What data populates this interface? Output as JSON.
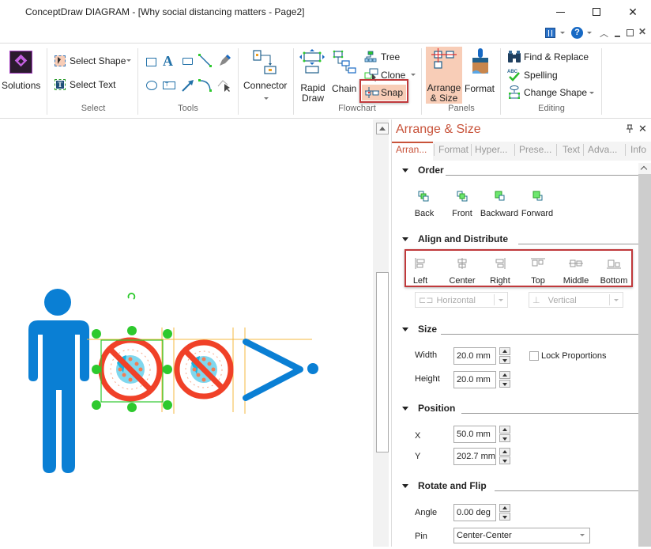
{
  "window": {
    "title": "ConceptDraw DIAGRAM - [Why social distancing matters - Page2]",
    "controls": {
      "minimize": "—",
      "maximize": "☐",
      "close": "✕"
    }
  },
  "quick_bar": {
    "icons": [
      "panel-layout-icon",
      "help-icon",
      "collapse-ribbon-icon",
      "mdi-minimize-icon",
      "mdi-restore-icon",
      "mdi-close-icon"
    ],
    "help_glyph": "?",
    "collapse_glyph": "︿",
    "min_glyph": "_",
    "restore_glyph": "🗗",
    "close_glyph": "✕"
  },
  "ribbon": {
    "solutions": {
      "label": "Solutions"
    },
    "select_group": {
      "label": "Select",
      "select_shape": "Select Shape",
      "select_text": "Select Text"
    },
    "tools_group": {
      "label": "Tools"
    },
    "connector": {
      "label": "Connector"
    },
    "flowchart_group": {
      "label": "Flowchart",
      "rapid_draw_1": "Rapid",
      "rapid_draw_2": "Draw",
      "chain": "Chain",
      "tree": "Tree",
      "clone": "Clone",
      "snap": "Snap"
    },
    "panels_group": {
      "label": "Panels",
      "arrange_1": "Arrange",
      "arrange_2": "& Size",
      "format": "Format"
    },
    "editing_group": {
      "label": "Editing",
      "find_replace": "Find & Replace",
      "spelling": "Spelling",
      "change_shape": "Change Shape"
    }
  },
  "panel": {
    "title": "Arrange & Size",
    "pin_glyph": "📌",
    "close_glyph": "✕",
    "tabs": [
      {
        "label": "Arran...",
        "active": true
      },
      {
        "label": "Format",
        "active": false
      },
      {
        "label": "Hyper...",
        "active": false
      },
      {
        "label": "Prese...",
        "active": false
      },
      {
        "label": "Text",
        "active": false
      },
      {
        "label": "Adva...",
        "active": false
      },
      {
        "label": "Info",
        "active": false
      }
    ],
    "order": {
      "heading": "Order",
      "buttons": [
        "Back",
        "Front",
        "Backward",
        "Forward"
      ]
    },
    "align": {
      "heading": "Align and Distribute",
      "buttons": [
        "Left",
        "Center",
        "Right",
        "Top",
        "Middle",
        "Bottom"
      ],
      "horizontal": "Horizontal",
      "vertical": "Vertical"
    },
    "size": {
      "heading": "Size",
      "width_label": "Width",
      "width_value": "20.0 mm",
      "height_label": "Height",
      "height_value": "20.0 mm",
      "lock_label": "Lock Proportions",
      "lock_checked": false
    },
    "position": {
      "heading": "Position",
      "x_label": "X",
      "x_value": "50.0 mm",
      "y_label": "Y",
      "y_value": "202.7 mm"
    },
    "rotate": {
      "heading": "Rotate and Flip",
      "angle_label": "Angle",
      "angle_value": "0.00 deg",
      "pin_label": "Pin",
      "pin_value": "Center-Center"
    }
  },
  "colors": {
    "accent": "#c8533a",
    "highlight": "#f8cdb7",
    "callout_border": "#c0393b",
    "person_blue": "#0a7fd4",
    "virus_red": "#f04128",
    "selection_green": "#2dc92d",
    "guide_orange": "#f5b942"
  }
}
